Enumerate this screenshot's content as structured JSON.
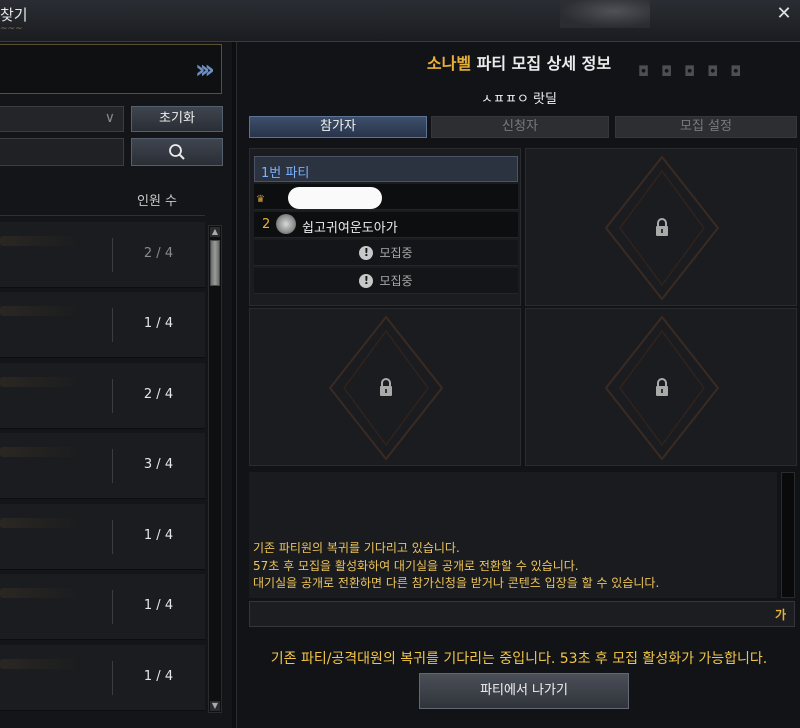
{
  "window": {
    "title": "찾기",
    "close_icon": "✕"
  },
  "left_panel": {
    "reset_label": "초기화",
    "column_header_count": "인원 수",
    "rows": [
      {
        "count": "2 / 4",
        "dim": true
      },
      {
        "count": "1 / 4",
        "dim": false
      },
      {
        "count": "2 / 4",
        "dim": false
      },
      {
        "count": "3 / 4",
        "dim": false
      },
      {
        "count": "1 / 4",
        "dim": false
      },
      {
        "count": "1 / 4",
        "dim": false
      },
      {
        "count": "1 / 4",
        "dim": false
      }
    ]
  },
  "detail": {
    "title_highlight": "소나벨",
    "title_rest": " 파티 모집 상세 정보",
    "raid_name": "ㅅㅍㅍㅇ 랏딜",
    "tabs": {
      "participants": "참가자",
      "applicants": "신청자",
      "settings": "모집 설정"
    },
    "party": {
      "header": "1번 파티",
      "member2_num": "2",
      "member2_name": "쉽고귀여운도아가",
      "recruiting": "모집중"
    },
    "chat_lines": [
      "기존 파티원의 복귀를 기다리고 있습니다.",
      "57초 후 모집을 활성화하여 대기실을 공개로 전환할 수 있습니다.",
      "대기실을 공개로 전환하면 다른 참가신청을 받거나 콘텐츠 입장을 할 수 있습니다."
    ],
    "chat_send": "가",
    "status_message": "기존 파티/공격대원의 복귀를 기다리는 중입니다. 53초 후 모집 활성화가 가능합니다.",
    "leave_button": "파티에서 나가기"
  },
  "colors": {
    "accent_gold": "#e8b23a",
    "accent_blue": "#7ab1ff"
  }
}
